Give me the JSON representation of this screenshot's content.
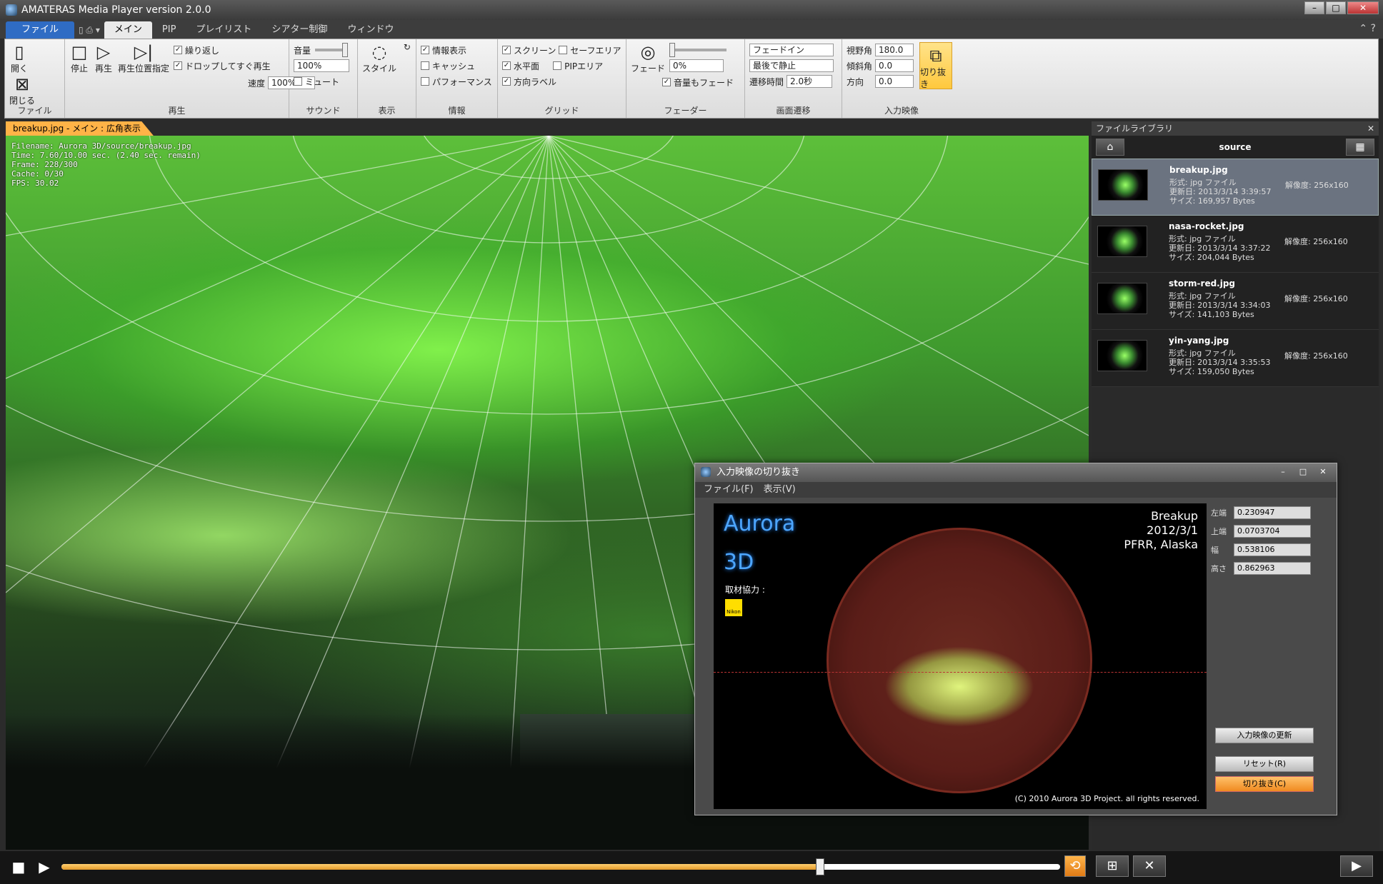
{
  "window": {
    "title": "AMATERAS Media Player version 2.0.0"
  },
  "ribbon_tabs": [
    "ファイル",
    "メイン",
    "PIP",
    "プレイリスト",
    "シアター制御",
    "ウィンドウ"
  ],
  "ribbon": {
    "file": {
      "open": "開く",
      "close": "閉じる",
      "label": "ファイル"
    },
    "play": {
      "stop": "停止",
      "play": "再生",
      "set_position": "再生位置指定",
      "repeat": "繰り返し",
      "play_on_drop": "ドロップしてすぐ再生",
      "speed_label": "速度",
      "speed_value": "100%",
      "label": "再生"
    },
    "sound": {
      "volume_label": "音量",
      "volume_value": "100%",
      "mute": "ミュート",
      "label": "サウンド"
    },
    "display": {
      "style": "スタイル",
      "label": "表示"
    },
    "info": {
      "show_info": "情報表示",
      "cache": "キャッシュ",
      "performance": "パフォーマンス",
      "label": "情報"
    },
    "grid": {
      "screen": "スクリーン",
      "safe_area": "セーフエリア",
      "horizon": "水平面",
      "pip_area": "PIPエリア",
      "direction_label": "方向ラベル",
      "label": "グリッド"
    },
    "fader": {
      "fade": "フェード",
      "value": "0%",
      "fade_volume": "音量もフェード",
      "label": "フェーダー"
    },
    "transition": {
      "mode": "フェードイン",
      "end": "最後で静止",
      "time_label": "遷移時間",
      "time_value": "2.0秒",
      "label": "画面遷移"
    },
    "input": {
      "fov_label": "視野角",
      "fov_value": "180.0",
      "tilt_label": "傾斜角",
      "tilt_value": "0.0",
      "direction_label": "方向",
      "direction_value": "0.0",
      "crop": "切り抜き",
      "label": "入力映像"
    }
  },
  "viewer": {
    "tab": "breakup.jpg - メイン : 広角表示",
    "info_lines": [
      "Filename: Aurora 3D/source/breakup.jpg",
      "Time: 7.60/10.00 sec. (2.40 sec. remain)",
      "Frame: 228/300",
      "Cache: 0/30",
      "FPS: 30.02"
    ],
    "progress": 0.76
  },
  "library": {
    "header": "ファイルライブラリ",
    "folder": "source",
    "files": [
      {
        "name": "breakup.jpg",
        "type": "形式: jpg ファイル",
        "date": "更新日: 2013/3/14 3:39:57",
        "size": "サイズ: 169,957 Bytes",
        "res": "解像度: 256x160"
      },
      {
        "name": "nasa-rocket.jpg",
        "type": "形式: jpg ファイル",
        "date": "更新日: 2013/3/14 3:37:22",
        "size": "サイズ: 204,044 Bytes",
        "res": "解像度: 256x160"
      },
      {
        "name": "storm-red.jpg",
        "type": "形式: jpg ファイル",
        "date": "更新日: 2013/3/14 3:34:03",
        "size": "サイズ: 141,103 Bytes",
        "res": "解像度: 256x160"
      },
      {
        "name": "yin-yang.jpg",
        "type": "形式: jpg ファイル",
        "date": "更新日: 2013/3/14 3:35:53",
        "size": "サイズ: 159,050 Bytes",
        "res": "解像度: 256x160"
      }
    ]
  },
  "dialog": {
    "title": "入力映像の切り抜き",
    "menu": [
      "ファイル(F)",
      "表示(V)"
    ],
    "brand1": "Aurora",
    "brand2": "3D",
    "coop": "取材協力 :",
    "nikon": "Nikon",
    "meta": [
      "Breakup",
      "2012/3/1",
      "PFRR, Alaska"
    ],
    "copyright": "(C) 2010  Aurora 3D Project. all rights reserved.",
    "params": [
      {
        "k": "左端",
        "v": "0.230947"
      },
      {
        "k": "上端",
        "v": "0.0703704"
      },
      {
        "k": "幅",
        "v": "0.538106"
      },
      {
        "k": "高さ",
        "v": "0.862963"
      }
    ],
    "btn_update": "入力映像の更新",
    "btn_reset": "リセット(R)",
    "btn_crop": "切り抜き(C)"
  }
}
